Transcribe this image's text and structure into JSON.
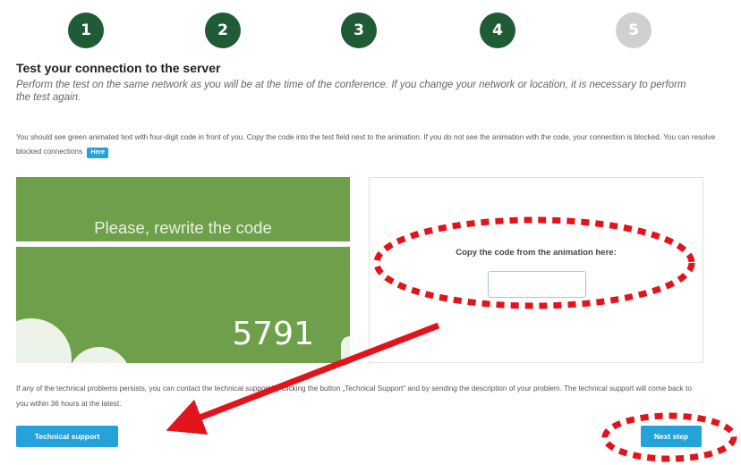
{
  "steps": [
    {
      "number": "1",
      "state": "done"
    },
    {
      "number": "2",
      "state": "done"
    },
    {
      "number": "3",
      "state": "done"
    },
    {
      "number": "4",
      "state": "done"
    },
    {
      "number": "5",
      "state": "pending"
    }
  ],
  "page": {
    "title": "Test your connection to the server",
    "subtitle": "Perform the test on the same network as you will be at the time of the conference. If you change your network or location, it is necessary to perform the test again.",
    "description": "You should see green animated text with four-digit code in front of you. Copy the code into the test field next to the animation. If you do not see the animation with the code, your connection is blocked. You can resolve blocked connections",
    "here_label": "Here"
  },
  "animation": {
    "prompt": "Please, rewrite the code",
    "code": "5791"
  },
  "code_entry": {
    "label": "Copy the code from the animation here:",
    "value": ""
  },
  "help": {
    "text": "If any of the technical problems persists, you can contact the technical support by clicking the button „Technical Support“ and by sending the description of your problem. The technical support will come back to you within 36 hours at the latest."
  },
  "buttons": {
    "support_label": "Technical support",
    "next_label": "Next step"
  },
  "colors": {
    "step_done": "#1f5c35",
    "step_pending": "#d0d0d0",
    "animation_green": "#6ea04c",
    "button_blue": "#23a3d9",
    "annotation_red": "#e0141a"
  }
}
